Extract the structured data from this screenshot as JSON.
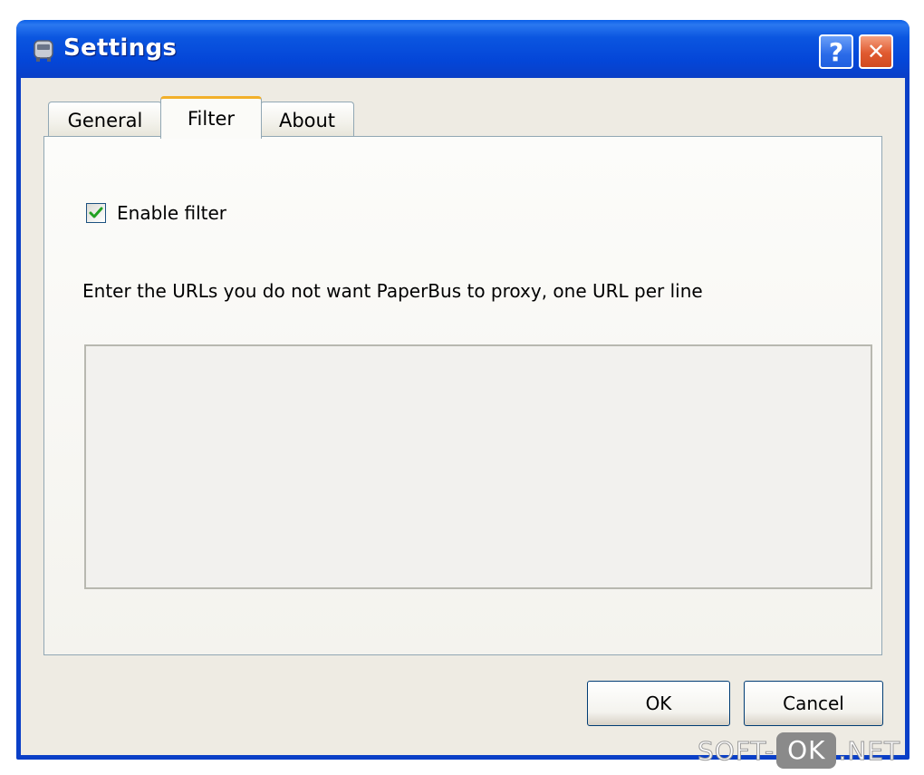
{
  "window": {
    "title": "Settings",
    "icon": "bus-icon",
    "help_label": "?",
    "close_label": "✕"
  },
  "tabs": [
    {
      "label": "General",
      "selected": false
    },
    {
      "label": "Filter",
      "selected": true
    },
    {
      "label": "About",
      "selected": false
    }
  ],
  "filter": {
    "enable_label": "Enable filter",
    "enable_checked": true,
    "instructions": "Enter the URLs you do not want PaperBus to proxy, one URL per line",
    "urls_value": ""
  },
  "buttons": {
    "ok_label": "OK",
    "cancel_label": "Cancel"
  },
  "watermark": {
    "left": "SOFT-",
    "middle": "OK",
    "right": ".NET"
  },
  "colors": {
    "titlebar": "#0446d8",
    "selected_tab_accent": "#f2b02a",
    "check": "#21a121",
    "close_button": "#e05a30"
  }
}
